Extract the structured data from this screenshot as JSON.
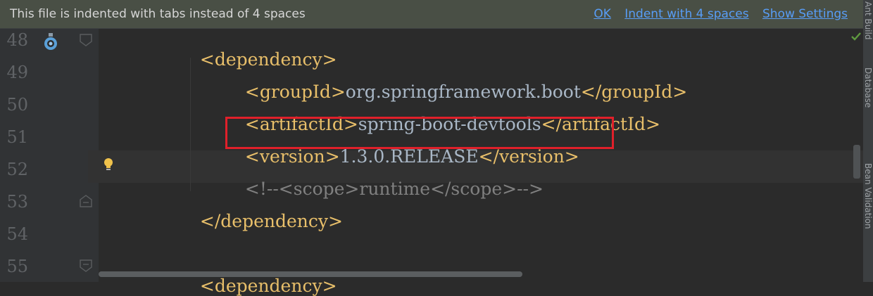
{
  "banner": {
    "message": "This file is indented with tabs instead of 4 spaces",
    "actions": [
      "OK",
      "Indent with 4 spaces",
      "Show Settings"
    ]
  },
  "line_numbers": [
    "48",
    "49",
    "50",
    "51",
    "52",
    "53",
    "54",
    "55"
  ],
  "code": {
    "l48_open": "<dependency>",
    "l49_open": "<groupId>",
    "l49_value": "org.springframework.boot",
    "l49_close": "</groupId>",
    "l50_open": "<artifactId>",
    "l50_value": "spring-boot-devtools",
    "l50_close": "</artifactId>",
    "l51_open": "<version>",
    "l51_value": "1.3.0.RELEASE",
    "l51_close": "</version>",
    "l52_comment": "<!--<scope>runtime</scope>-->",
    "l53_close": "</dependency>",
    "l55_open": "<dependency>"
  },
  "right_panel": {
    "labels": [
      "Ant Build",
      "Database",
      "Bean Validation"
    ]
  },
  "colors": {
    "tag": "#e8bf6a",
    "text": "#a9b7c6",
    "comment": "#808080",
    "highlight": "#e0202a",
    "link": "#589df6"
  }
}
